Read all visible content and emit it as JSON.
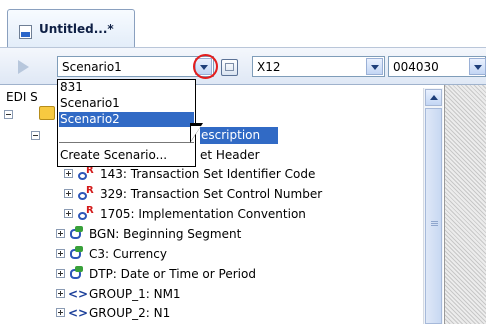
{
  "tab": {
    "title": "Untitled...*"
  },
  "toolbar": {
    "scenario_value": "Scenario1",
    "standard_value": "X12",
    "version_value": "004030"
  },
  "dropdown": {
    "items": [
      "831",
      "Scenario1",
      "Scenario2"
    ],
    "selected": "Scenario2",
    "create_label": "Create Scenario..."
  },
  "tree": {
    "root_label_partial": "EDI S",
    "desc_label_partial": "escription",
    "header_partial": "et Header",
    "rows": [
      {
        "text": "143: Transaction Set Identifier Code",
        "kind": "element"
      },
      {
        "text": "329: Transaction Set Control Number",
        "kind": "element"
      },
      {
        "text": "1705: Implementation Convention",
        "kind": "element"
      },
      {
        "text": "BGN: Beginning Segment",
        "kind": "segment"
      },
      {
        "text": "C3: Currency",
        "kind": "segment"
      },
      {
        "text": "DTP: Date or Time or Period",
        "kind": "segment"
      },
      {
        "text": "GROUP_1: NM1",
        "kind": "group"
      },
      {
        "text": "GROUP_2: N1",
        "kind": "group"
      }
    ]
  },
  "colors": {
    "selection": "#316ac5",
    "annotation_circle": "#e41e1e"
  }
}
